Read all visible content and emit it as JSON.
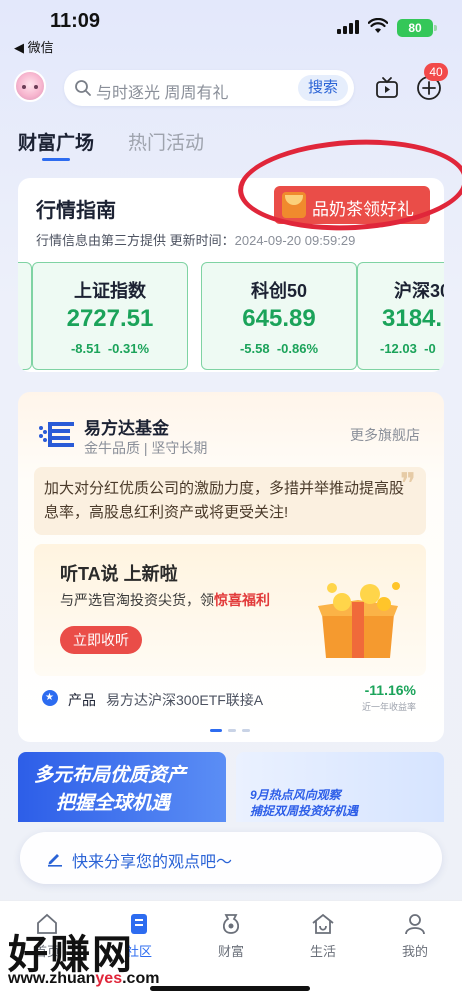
{
  "status_bar": {
    "time": "11:09",
    "back_app": "◀ 微信",
    "battery": "80"
  },
  "header": {
    "search_placeholder": "与时逐光 周周有礼",
    "search_button": "搜索",
    "badge_count": "40"
  },
  "tabs": [
    {
      "label": "财富广场",
      "active": true
    },
    {
      "label": "热门活动",
      "active": false
    }
  ],
  "market": {
    "title": "行情指南",
    "promo_label": "品奶茶领好礼",
    "note": "行情信息由第三方提供 更新时间：",
    "update_time": "2024-09-20 09:59:29",
    "indices": [
      {
        "name": "上证指数",
        "value": "2727.51",
        "change": "-8.51",
        "change_pct": "-0.31%"
      },
      {
        "name": "科创50",
        "value": "645.89",
        "change": "-5.58",
        "change_pct": "-0.86%"
      },
      {
        "name": "沪深30",
        "value": "3184.",
        "change": "-12.03",
        "change_pct": "-0"
      }
    ]
  },
  "fund": {
    "name": "易方达基金",
    "tagline": "金牛品质 | 坚守长期",
    "more_link": "更多旗舰店",
    "quote_mark": "❞",
    "quote": "加大对分红优质公司的激励力度，多措并举推动提高股息率，高股息红利资产或将更受关注!",
    "banner": {
      "title": "听TA说 上新啦",
      "subtitle_prefix": "与严选官淘投资尖货，领",
      "subtitle_highlight": "惊喜福利",
      "button": "立即收听"
    },
    "product": {
      "label": "产品",
      "name": "易方达沪深300ETF联接A",
      "return": "-11.16%",
      "return_label": "近一年收益率"
    }
  },
  "promos": {
    "left_line1": "多元布局优质资产",
    "left_line2": "把握全球机遇",
    "right_line1": "9月热点风向观察",
    "right_line2": "捕捉双周投资好机遇"
  },
  "share_bar": {
    "text": "快来分享您的观点吧～"
  },
  "bottom_nav": [
    {
      "label": "首页",
      "icon": "home-icon"
    },
    {
      "label": "社区",
      "icon": "community-icon",
      "active": true
    },
    {
      "label": "财富",
      "icon": "wealth-icon"
    },
    {
      "label": "生活",
      "icon": "life-icon"
    },
    {
      "label": "我的",
      "icon": "profile-icon"
    }
  ],
  "watermark": {
    "big": "好赚网",
    "url_a": "www.zhuan",
    "url_red": "yes",
    "url_b": ".com"
  },
  "colors": {
    "accent": "#2d6cf0",
    "up_green": "#1ba35a",
    "promo_red": "#ea4d48",
    "annotation_red": "#e0263a"
  }
}
